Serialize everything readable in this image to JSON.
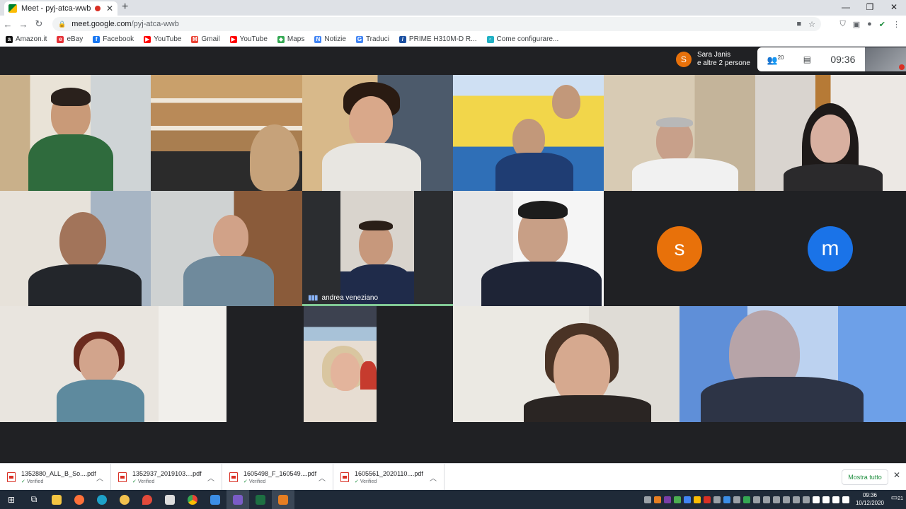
{
  "browser": {
    "tab_title": "Meet - pyj-atca-wwb",
    "tab_close": "✕",
    "new_tab": "+",
    "url_host": "meet.google.com",
    "url_path": "/pyj-atca-wwb",
    "window_controls": [
      "—",
      "❐",
      "✕"
    ]
  },
  "bookmarks": [
    {
      "label": "Amazon.it",
      "icon": "amazon-icon",
      "color": "#111111"
    },
    {
      "label": "eBay",
      "icon": "ebay-icon",
      "color": "#e53238"
    },
    {
      "label": "Facebook",
      "icon": "facebook-icon",
      "color": "#1877f2"
    },
    {
      "label": "YouTube",
      "icon": "youtube-icon",
      "color": "#ff0000"
    },
    {
      "label": "Gmail",
      "icon": "gmail-icon",
      "color": "#ea4335"
    },
    {
      "label": "YouTube",
      "icon": "youtube-icon",
      "color": "#ff0000"
    },
    {
      "label": "Maps",
      "icon": "maps-icon",
      "color": "#34a853"
    },
    {
      "label": "Notizie",
      "icon": "news-icon",
      "color": "#4285f4"
    },
    {
      "label": "Traduci",
      "icon": "translate-icon",
      "color": "#4285f4"
    },
    {
      "label": "PRIME H310M-D R...",
      "icon": "asus-icon",
      "color": "#1a4fa0"
    },
    {
      "label": "Come configurare...",
      "icon": "page-icon",
      "color": "#21b1c4"
    }
  ],
  "meet": {
    "presenter_initial": "S",
    "presenter_line1": "Sara Janis",
    "presenter_line2": "e altre 2 persone",
    "participants_count": "20",
    "time": "09:36",
    "speaker_name": "andrea veneziano",
    "initial_s": "s",
    "initial_m": "m",
    "colors": {
      "orange_avatar": "#e8710a",
      "blue_avatar": "#1a73e8",
      "speaking": "#81c995"
    }
  },
  "downloads": [
    {
      "file": "1352880_ALL_B_So....pdf",
      "status": "Verified"
    },
    {
      "file": "1352937_2019103....pdf",
      "status": "Verified"
    },
    {
      "file": "1605498_F_160549....pdf",
      "status": "Verified"
    },
    {
      "file": "1605561_2020110....pdf",
      "status": "Verified"
    }
  ],
  "downloads_show_all": "Mostra tutto",
  "downloads_close": "✕",
  "taskbar": {
    "time": "09:36",
    "date": "10/12/2020",
    "notifications": "21"
  }
}
